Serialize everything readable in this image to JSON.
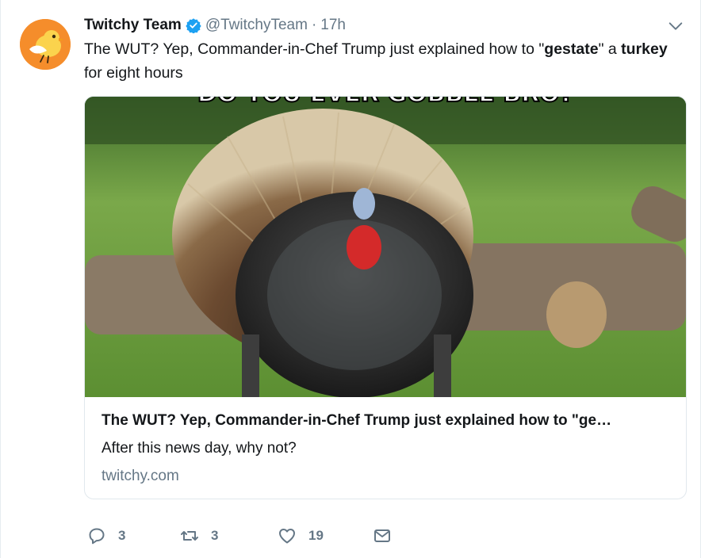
{
  "tweet": {
    "author_name": "Twitchy Team",
    "handle": "@TwitchyTeam",
    "separator": "·",
    "time": "17h",
    "text_parts": {
      "p1": "The WUT? Yep, Commander-in-Chef Trump just explained how to \"",
      "b1": "gestate",
      "p2": "\" a ",
      "b2": "turkey",
      "p3": " for eight hours"
    },
    "verified": true,
    "more_icon": "chevron-down-icon"
  },
  "card": {
    "image_text": "DO YOU EVER GOBBLE BRO?",
    "title": "The WUT? Yep, Commander-in-Chef Trump just explained how to \"ge…",
    "description": "After this news day, why not?",
    "domain": "twitchy.com"
  },
  "actions": {
    "reply_count": "3",
    "retweet_count": "3",
    "like_count": "19",
    "icons": [
      "reply-icon",
      "retweet-icon",
      "like-icon",
      "direct-message-icon"
    ]
  },
  "colors": {
    "brand_blue": "#1da1f2",
    "secondary_text": "#657786",
    "avatar_orange": "#f58d2b",
    "border": "#e1e8ed"
  }
}
